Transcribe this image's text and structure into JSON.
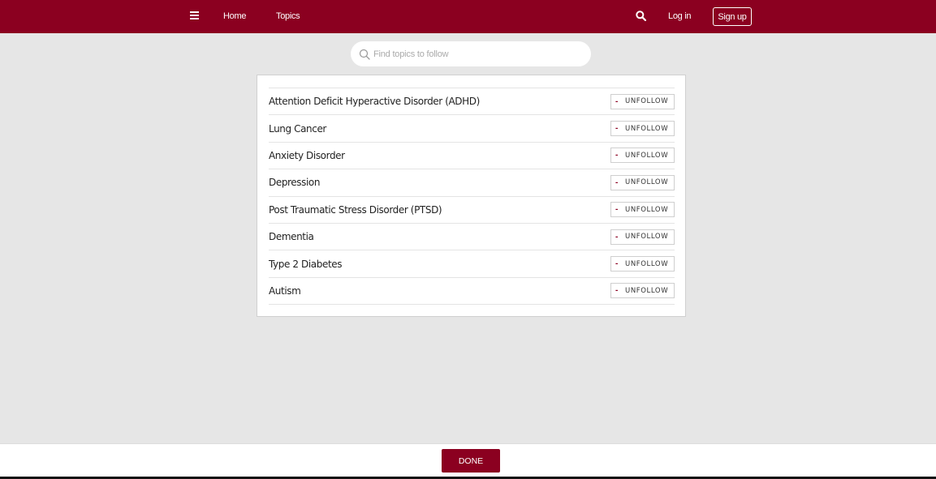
{
  "header": {
    "menu_icon": "hamburger-icon",
    "nav": {
      "home": "Home",
      "topics": "Topics"
    },
    "search_icon": "search-icon",
    "login": "Log in",
    "signup": "Sign up"
  },
  "search": {
    "placeholder": "Find topics to follow",
    "value": ""
  },
  "topics": [
    {
      "name": "Attention Deficit Hyperactive Disorder (ADHD)",
      "action": "UNFOLLOW"
    },
    {
      "name": "Lung Cancer",
      "action": "UNFOLLOW"
    },
    {
      "name": "Anxiety Disorder",
      "action": "UNFOLLOW"
    },
    {
      "name": "Depression",
      "action": "UNFOLLOW"
    },
    {
      "name": "Post Traumatic Stress Disorder (PTSD)",
      "action": "UNFOLLOW"
    },
    {
      "name": "Dementia",
      "action": "UNFOLLOW"
    },
    {
      "name": "Type 2 Diabetes",
      "action": "UNFOLLOW"
    },
    {
      "name": "Autism",
      "action": "UNFOLLOW"
    }
  ],
  "footer": {
    "done": "DONE"
  },
  "colors": {
    "brand": "#8b0020",
    "background": "#e6e6e6"
  }
}
